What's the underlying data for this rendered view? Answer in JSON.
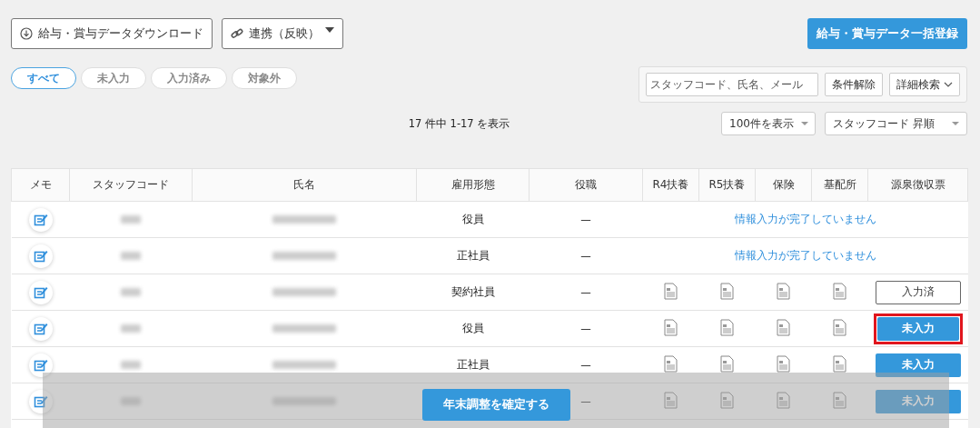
{
  "toolbar": {
    "download_button": "給与・賞与データダウンロード",
    "link_button": "連携（反映）",
    "bulk_register_button": "給与・賞与データ一括登録"
  },
  "filter_tabs": [
    {
      "label": "すべて",
      "selected": true
    },
    {
      "label": "未入力",
      "selected": false
    },
    {
      "label": "入力済み",
      "selected": false
    },
    {
      "label": "対象外",
      "selected": false
    }
  ],
  "search": {
    "placeholder": "スタッフコード、氏名、メール",
    "clear_button": "条件解除",
    "advanced_button": "詳細検索"
  },
  "result_count": "17 件中 1-17 を表示",
  "page_size_select": "100件を表示",
  "sort_select": "スタッフコード 昇順",
  "table": {
    "columns": [
      "メモ",
      "スタッフコード",
      "氏名",
      "雇用形態",
      "役職",
      "R4扶養",
      "R5扶養",
      "保険",
      "基配所",
      "源泉徴収票"
    ],
    "rows": [
      {
        "kind": "incomplete",
        "employment_type": "役員",
        "position": "—",
        "message": "情報入力が完了していません"
      },
      {
        "kind": "incomplete",
        "employment_type": "正社員",
        "position": "—",
        "message": "情報入力が完了していません"
      },
      {
        "kind": "complete",
        "employment_type": "契約社員",
        "position": "—",
        "status": "入力済",
        "entered": true,
        "highlighted": false
      },
      {
        "kind": "complete",
        "employment_type": "役員",
        "position": "—",
        "status": "未入力",
        "entered": false,
        "highlighted": true
      },
      {
        "kind": "complete",
        "employment_type": "正社員",
        "position": "—",
        "status": "未入力",
        "entered": false,
        "highlighted": false
      },
      {
        "kind": "complete",
        "employment_type": "",
        "position": "—",
        "status": "未入力",
        "entered": false,
        "highlighted": false
      }
    ]
  },
  "confirm_button": "年末調整を確定する"
}
